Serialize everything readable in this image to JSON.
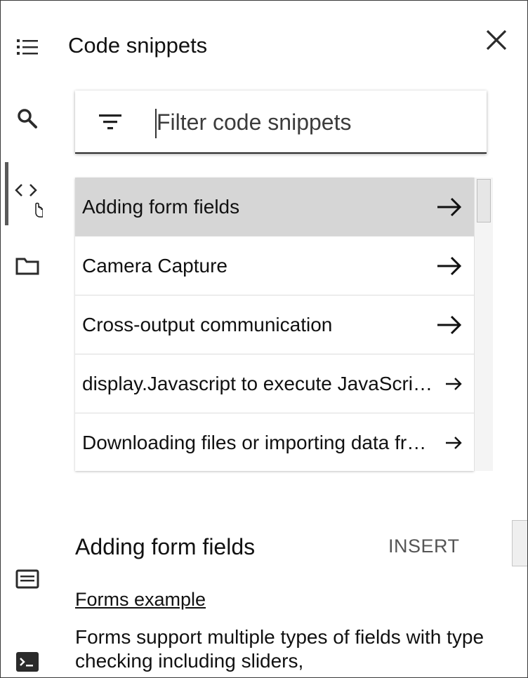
{
  "header": {
    "title": "Code snippets"
  },
  "rail": {
    "icons": [
      "toc-icon",
      "search-icon",
      "code-icon",
      "folder-icon",
      "terminal-list-icon",
      "terminal-icon"
    ],
    "active": "code-icon"
  },
  "search": {
    "placeholder": "Filter code snippets",
    "value": ""
  },
  "list": {
    "items": [
      {
        "label": "Adding form fields",
        "selected": true
      },
      {
        "label": "Camera Capture",
        "selected": false
      },
      {
        "label": "Cross-output communication",
        "selected": false
      },
      {
        "label": "display.Javascript to execute JavaScript from Python",
        "selected": false
      },
      {
        "label": "Downloading files or importing data from Google Drive",
        "selected": false
      }
    ]
  },
  "detail": {
    "title": "Adding form fields",
    "insert_label": "INSERT",
    "link_text": "Forms example",
    "description": "Forms support multiple types of fields with type checking including sliders,"
  },
  "colors": {
    "selected_row": "#d6d6d6",
    "text": "#111111",
    "muted": "#555555"
  }
}
